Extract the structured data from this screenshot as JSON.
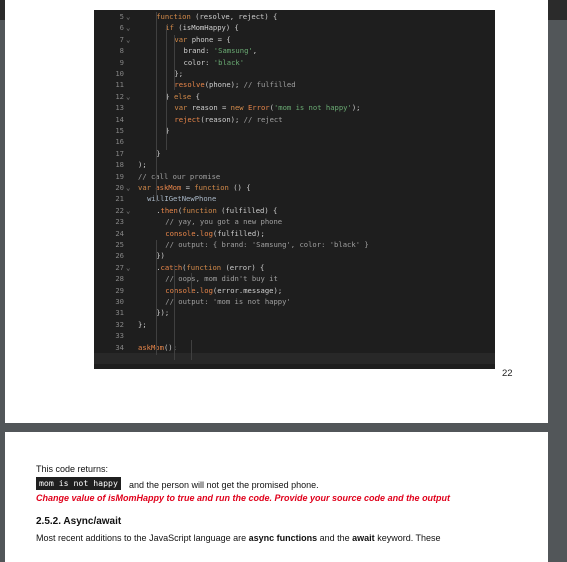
{
  "code_lines": [
    {
      "n": "5",
      "fold": "⌄",
      "segs": [
        [
          "kw",
          "function "
        ],
        [
          "pl",
          "(resolve, reject) {"
        ]
      ]
    },
    {
      "n": "6",
      "fold": "⌄",
      "segs": [
        [
          "kw",
          "if "
        ],
        [
          "pl",
          "(isMomHappy) {"
        ]
      ]
    },
    {
      "n": "7",
      "fold": "⌄",
      "segs": [
        [
          "kw",
          "var "
        ],
        [
          "pl",
          "phone = {"
        ]
      ]
    },
    {
      "n": "8",
      "fold": "",
      "segs": [
        [
          "pl",
          "brand: "
        ],
        [
          "str",
          "'Samsung'"
        ],
        [
          "pl",
          ","
        ]
      ]
    },
    {
      "n": "9",
      "fold": "",
      "segs": [
        [
          "pl",
          "color: "
        ],
        [
          "str",
          "'black'"
        ]
      ]
    },
    {
      "n": "10",
      "fold": "",
      "segs": [
        [
          "pl",
          "};"
        ]
      ]
    },
    {
      "n": "11",
      "fold": "",
      "segs": [
        [
          "id",
          "resolve"
        ],
        [
          "pl",
          "(phone); "
        ],
        [
          "cm",
          "// fulfilled"
        ]
      ]
    },
    {
      "n": "12",
      "fold": "⌄",
      "segs": [
        [
          "pl",
          "} "
        ],
        [
          "kw",
          "else "
        ],
        [
          "pl",
          "{"
        ]
      ]
    },
    {
      "n": "13",
      "fold": "",
      "segs": [
        [
          "kw",
          "var "
        ],
        [
          "pl",
          "reason = "
        ],
        [
          "kw",
          "new "
        ],
        [
          "id",
          "Error"
        ],
        [
          "pl",
          "("
        ],
        [
          "str",
          "'mom is not happy'"
        ],
        [
          "pl",
          ");"
        ]
      ]
    },
    {
      "n": "14",
      "fold": "",
      "segs": [
        [
          "id",
          "reject"
        ],
        [
          "pl",
          "(reason); "
        ],
        [
          "cm",
          "// reject"
        ]
      ]
    },
    {
      "n": "15",
      "fold": "",
      "segs": [
        [
          "pl",
          "}"
        ]
      ]
    },
    {
      "n": "16",
      "fold": "",
      "segs": []
    },
    {
      "n": "17",
      "fold": "",
      "segs": [
        [
          "pl",
          "}"
        ]
      ]
    },
    {
      "n": "18",
      "fold": "",
      "segs": [
        [
          "pl",
          ");"
        ]
      ]
    },
    {
      "n": "19",
      "fold": "",
      "segs": [
        [
          "cm",
          "// call our promise"
        ]
      ]
    },
    {
      "n": "20",
      "fold": "⌄",
      "segs": [
        [
          "kw",
          "var "
        ],
        [
          "id",
          "askMom "
        ],
        [
          "pl",
          "= "
        ],
        [
          "kw",
          "function "
        ],
        [
          "pl",
          "() {"
        ]
      ]
    },
    {
      "n": "21",
      "fold": "",
      "segs": [
        [
          "fn",
          "willIGetNewPhone"
        ]
      ]
    },
    {
      "n": "22",
      "fold": "⌄",
      "segs": [
        [
          "pl",
          "."
        ],
        [
          "id",
          "then"
        ],
        [
          "pl",
          "("
        ],
        [
          "kw",
          "function "
        ],
        [
          "pl",
          "(fulfilled) {"
        ]
      ]
    },
    {
      "n": "23",
      "fold": "",
      "segs": [
        [
          "cm",
          "// yay, you got a new phone"
        ]
      ]
    },
    {
      "n": "24",
      "fold": "",
      "segs": [
        [
          "id",
          "console"
        ],
        [
          "pl",
          "."
        ],
        [
          "id",
          "log"
        ],
        [
          "pl",
          "(fulfilled);"
        ]
      ]
    },
    {
      "n": "25",
      "fold": "",
      "segs": [
        [
          "cm",
          "// output: { brand: 'Samsung', color: 'black' }"
        ]
      ]
    },
    {
      "n": "26",
      "fold": "",
      "segs": [
        [
          "pl",
          "})"
        ]
      ]
    },
    {
      "n": "27",
      "fold": "⌄",
      "segs": [
        [
          "pl",
          "."
        ],
        [
          "id",
          "catch"
        ],
        [
          "pl",
          "("
        ],
        [
          "kw",
          "function "
        ],
        [
          "pl",
          "(error) {"
        ]
      ]
    },
    {
      "n": "28",
      "fold": "",
      "segs": [
        [
          "cm",
          "// oops, mom didn't buy it"
        ]
      ]
    },
    {
      "n": "29",
      "fold": "",
      "segs": [
        [
          "id",
          "console"
        ],
        [
          "pl",
          "."
        ],
        [
          "id",
          "log"
        ],
        [
          "pl",
          "(error.message);"
        ]
      ]
    },
    {
      "n": "30",
      "fold": "",
      "segs": [
        [
          "cm",
          "// output: 'mom is not happy'"
        ]
      ]
    },
    {
      "n": "31",
      "fold": "",
      "segs": [
        [
          "pl",
          "});"
        ]
      ]
    },
    {
      "n": "32",
      "fold": "",
      "segs": [
        [
          "pl",
          "};"
        ]
      ]
    },
    {
      "n": "33",
      "fold": "",
      "segs": []
    },
    {
      "n": "34",
      "fold": "",
      "segs": [
        [
          "id",
          "askMom"
        ],
        [
          "pl",
          "();"
        ]
      ]
    }
  ],
  "page1": {
    "page_number": "22"
  },
  "page2": {
    "returns_text": "This code returns:",
    "returns_badge": "mom is not happy",
    "returns_tail": "and the person will not get the promised phone.",
    "instruction": "Change value of isMomHappy to true and run the code. Provide your source code and the output",
    "section_heading": "2.5.2. Async/await",
    "para_start": "Most recent additions to the JavaScript language are ",
    "para_bold1": "async functions",
    "para_mid": " and the ",
    "para_bold2": "await",
    "para_end": " keyword. These"
  },
  "colors": {
    "viewer_bg": "#525659",
    "code_bg": "#1e1e1e",
    "instruction_red": "#e0001b"
  }
}
